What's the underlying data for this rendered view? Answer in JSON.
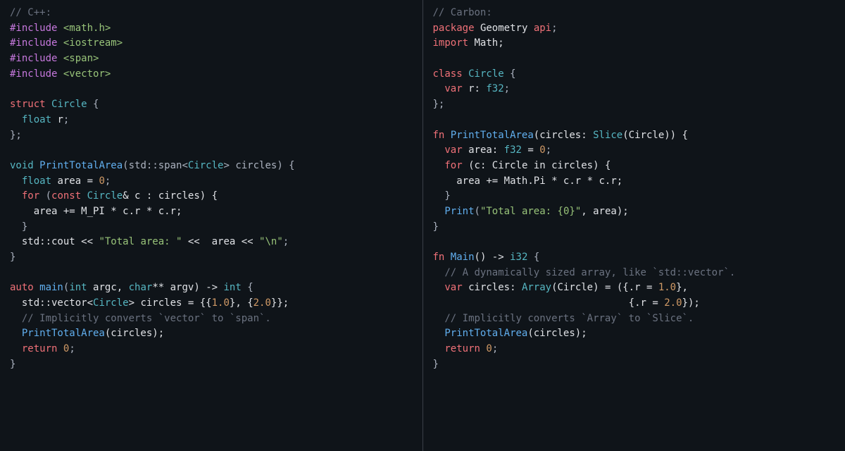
{
  "cpp": {
    "comment_header": "// C++:",
    "include1_kw": "#include",
    "include1_hdr": "<math.h>",
    "include2_kw": "#include",
    "include2_hdr": "<iostream>",
    "include3_kw": "#include",
    "include3_hdr": "<span>",
    "include4_kw": "#include",
    "include4_hdr": "<vector>",
    "struct_kw": "struct",
    "struct_name": "Circle",
    "struct_open": " {",
    "field_type": "float",
    "field_name": "r",
    "field_semi": ";",
    "struct_close": "};",
    "fn1_ret": "void",
    "fn1_name": "PrintTotalArea",
    "fn1_sig_a": "(std::span<",
    "fn1_sig_ty": "Circle",
    "fn1_sig_b": "> circles) {",
    "fn1_l1_ty": "float",
    "fn1_l1_rest": " area = ",
    "fn1_l1_num": "0",
    "fn1_l1_semi": ";",
    "fn1_for_kw": "for",
    "fn1_for_open": " (",
    "fn1_for_const": "const",
    "fn1_for_ty": " Circle",
    "fn1_for_amp": "&",
    "fn1_for_rest": " c : circles) {",
    "fn1_body": "    area += M_PI * c.r * c.r;",
    "fn1_for_close": "  }",
    "fn1_cout_a": "  std::cout << ",
    "fn1_cout_str": "\"Total area: \"",
    "fn1_cout_b": " <<  area << ",
    "fn1_cout_nl": "\"\\n\"",
    "fn1_cout_semi": ";",
    "fn1_close": "}",
    "main_auto": "auto",
    "main_name": " main",
    "main_sig_open": "(",
    "main_int1": "int",
    "main_argc": " argc, ",
    "main_char": "char",
    "main_argv": "** argv) -> ",
    "main_ret": "int",
    "main_open": " {",
    "main_vec_a": "  std::vector<",
    "main_vec_ty": "Circle",
    "main_vec_b": "> circles = {{",
    "main_vec_n1": "1.0",
    "main_vec_c": "}, {",
    "main_vec_n2": "2.0",
    "main_vec_d": "}};",
    "main_cm": "  // Implicitly converts `vector` to `span`.",
    "main_call_fn": "  PrintTotalArea",
    "main_call_args": "(circles);",
    "main_ret_kw": "return",
    "main_ret_val": "0",
    "main_ret_semi": ";",
    "main_close": "}"
  },
  "carbon": {
    "comment_header": "// Carbon:",
    "pkg_kw": "package",
    "pkg_name": " Geometry ",
    "pkg_api": "api",
    "pkg_semi": ";",
    "imp_kw": "import",
    "imp_name": " Math;",
    "class_kw": "class",
    "class_name": " Circle",
    "class_open": " {",
    "var_kw": "var",
    "var_name": " r: ",
    "var_ty": "f32",
    "var_semi": ";",
    "class_close": "};",
    "fn1_kw": "fn",
    "fn1_name": " PrintTotalArea",
    "fn1_sig_a": "(circles: ",
    "fn1_slice": "Slice",
    "fn1_sig_b": "(Circle)) {",
    "fn1_var_kw": "var",
    "fn1_var_a": " area: ",
    "fn1_var_ty": "f32",
    "fn1_var_eq": " = ",
    "fn1_var_num": "0",
    "fn1_var_semi": ";",
    "fn1_for_kw": "for",
    "fn1_for_rest": " (c: Circle in circles) {",
    "fn1_body": "    area += Math.Pi * c.r * c.r;",
    "fn1_for_close": "  }",
    "fn1_print": "  Print",
    "fn1_print_open": "(",
    "fn1_print_str": "\"Total area: {0}\"",
    "fn1_print_rest": ", area);",
    "fn1_close": "}",
    "main_kw": "fn",
    "main_name": " Main",
    "main_sig": "() -> ",
    "main_ret": "i32",
    "main_open": " {",
    "main_cm1": "  // A dynamically sized array, like `std::vector`.",
    "main_var_kw": "var",
    "main_var_a": " circles: ",
    "main_arr": "Array",
    "main_var_b": "(Circle) = ({.r = ",
    "main_n1": "1.0",
    "main_var_c": "},",
    "main_line2": "                                 {.r = ",
    "main_n2": "2.0",
    "main_line2_end": "});",
    "main_cm2": "  // Implicitly converts `Array` to `Slice`.",
    "main_call": "  PrintTotalArea",
    "main_call_args": "(circles);",
    "main_ret_kw": "return",
    "main_ret_val": "0",
    "main_ret_semi": ";",
    "main_close": "}"
  }
}
